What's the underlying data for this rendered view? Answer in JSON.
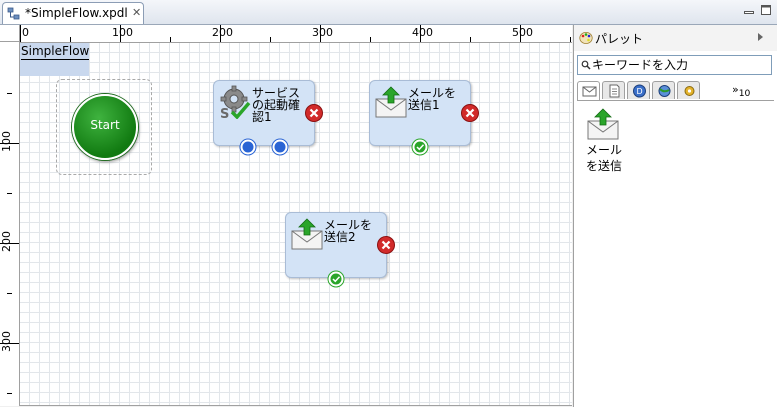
{
  "editor": {
    "tab_title": "*SimpleFlow.xpdl",
    "minimize_label": "minimize",
    "maximize_label": "maximize"
  },
  "ruler": {
    "horizontal": [
      "0",
      "100",
      "200",
      "300",
      "400",
      "500"
    ],
    "vertical": [
      "100",
      "200",
      "300"
    ]
  },
  "diagram": {
    "pool_name": "SimpleFlow",
    "start_label": "Start",
    "nodes": [
      {
        "label": "サービスの起動確認1",
        "icon": "service-gear-icon"
      },
      {
        "label": "メールを送信1",
        "icon": "mail-send-icon"
      },
      {
        "label": "メールを送信2",
        "icon": "mail-send-icon"
      }
    ]
  },
  "palette": {
    "title": "パレット",
    "search_placeholder": "キーワードを入力",
    "more_count": "10",
    "item_label": "メールを送信"
  },
  "colors": {
    "node_fill": "#d3e3f6",
    "start_green": "#1a8a1a",
    "delete_red": "#cc2222",
    "port_blue": "#2a64d4",
    "port_green": "#2aa52a"
  }
}
